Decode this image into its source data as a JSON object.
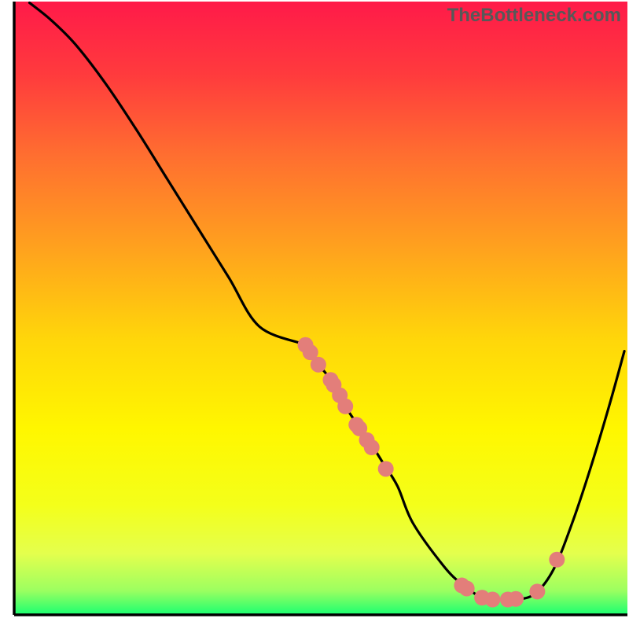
{
  "watermark": "TheBottleneck.com",
  "chart_data": {
    "type": "line",
    "title": "",
    "xlabel": "",
    "ylabel": "",
    "xlim": [
      0,
      100
    ],
    "ylim": [
      0,
      100
    ],
    "curve": [
      {
        "x": 2.5,
        "y": 99.8
      },
      {
        "x": 6.0,
        "y": 97.0
      },
      {
        "x": 10.0,
        "y": 93.0
      },
      {
        "x": 15.0,
        "y": 86.5
      },
      {
        "x": 20.0,
        "y": 79.0
      },
      {
        "x": 25.0,
        "y": 71.0
      },
      {
        "x": 30.0,
        "y": 63.0
      },
      {
        "x": 35.0,
        "y": 55.0
      },
      {
        "x": 40.0,
        "y": 47.0
      },
      {
        "x": 45.0,
        "y": 39.0
      },
      {
        "x": 47.5,
        "y": 44.0
      },
      {
        "x": 48.0,
        "y": 43.0
      },
      {
        "x": 49.5,
        "y": 41.0
      },
      {
        "x": 51.5,
        "y": 38.5
      },
      {
        "x": 53.0,
        "y": 36.0
      },
      {
        "x": 54.0,
        "y": 34.0
      },
      {
        "x": 56.0,
        "y": 31.0
      },
      {
        "x": 57.5,
        "y": 29.0
      },
      {
        "x": 60.0,
        "y": 25.0
      },
      {
        "x": 62.5,
        "y": 21.0
      },
      {
        "x": 65.0,
        "y": 15.0
      },
      {
        "x": 70.0,
        "y": 8.0
      },
      {
        "x": 73.0,
        "y": 5.0
      },
      {
        "x": 76.0,
        "y": 3.0
      },
      {
        "x": 79.0,
        "y": 2.5
      },
      {
        "x": 82.0,
        "y": 2.5
      },
      {
        "x": 85.0,
        "y": 3.5
      },
      {
        "x": 88.0,
        "y": 7.5
      },
      {
        "x": 91.0,
        "y": 15.0
      },
      {
        "x": 94.0,
        "y": 24.0
      },
      {
        "x": 97.0,
        "y": 34.0
      },
      {
        "x": 99.5,
        "y": 43.0
      }
    ],
    "markers": [
      {
        "x": 47.5,
        "y": 44.0
      },
      {
        "x": 48.3,
        "y": 42.8
      },
      {
        "x": 49.6,
        "y": 40.8
      },
      {
        "x": 51.6,
        "y": 38.3
      },
      {
        "x": 52.1,
        "y": 37.5
      },
      {
        "x": 53.1,
        "y": 35.8
      },
      {
        "x": 54.0,
        "y": 34.0
      },
      {
        "x": 55.8,
        "y": 31.0
      },
      {
        "x": 56.3,
        "y": 30.4
      },
      {
        "x": 57.5,
        "y": 28.5
      },
      {
        "x": 58.3,
        "y": 27.3
      },
      {
        "x": 60.6,
        "y": 23.8
      },
      {
        "x": 73.0,
        "y": 4.8
      },
      {
        "x": 73.8,
        "y": 4.3
      },
      {
        "x": 76.3,
        "y": 2.8
      },
      {
        "x": 78.0,
        "y": 2.5
      },
      {
        "x": 80.5,
        "y": 2.5
      },
      {
        "x": 81.8,
        "y": 2.6
      },
      {
        "x": 85.3,
        "y": 3.8
      },
      {
        "x": 88.5,
        "y": 9.0
      }
    ],
    "gradient_stops": [
      {
        "offset": 0.0,
        "color": "#ff1a49"
      },
      {
        "offset": 0.12,
        "color": "#ff3b3d"
      },
      {
        "offset": 0.25,
        "color": "#ff6e30"
      },
      {
        "offset": 0.4,
        "color": "#ffa11e"
      },
      {
        "offset": 0.55,
        "color": "#ffd60a"
      },
      {
        "offset": 0.7,
        "color": "#fff700"
      },
      {
        "offset": 0.82,
        "color": "#f4ff1a"
      },
      {
        "offset": 0.9,
        "color": "#e4ff4d"
      },
      {
        "offset": 0.96,
        "color": "#9dff60"
      },
      {
        "offset": 1.0,
        "color": "#1aff71"
      }
    ],
    "axis_color": "#000000",
    "curve_color": "#000000",
    "marker_color": "#e37e7a",
    "marker_radius_px": 10
  }
}
